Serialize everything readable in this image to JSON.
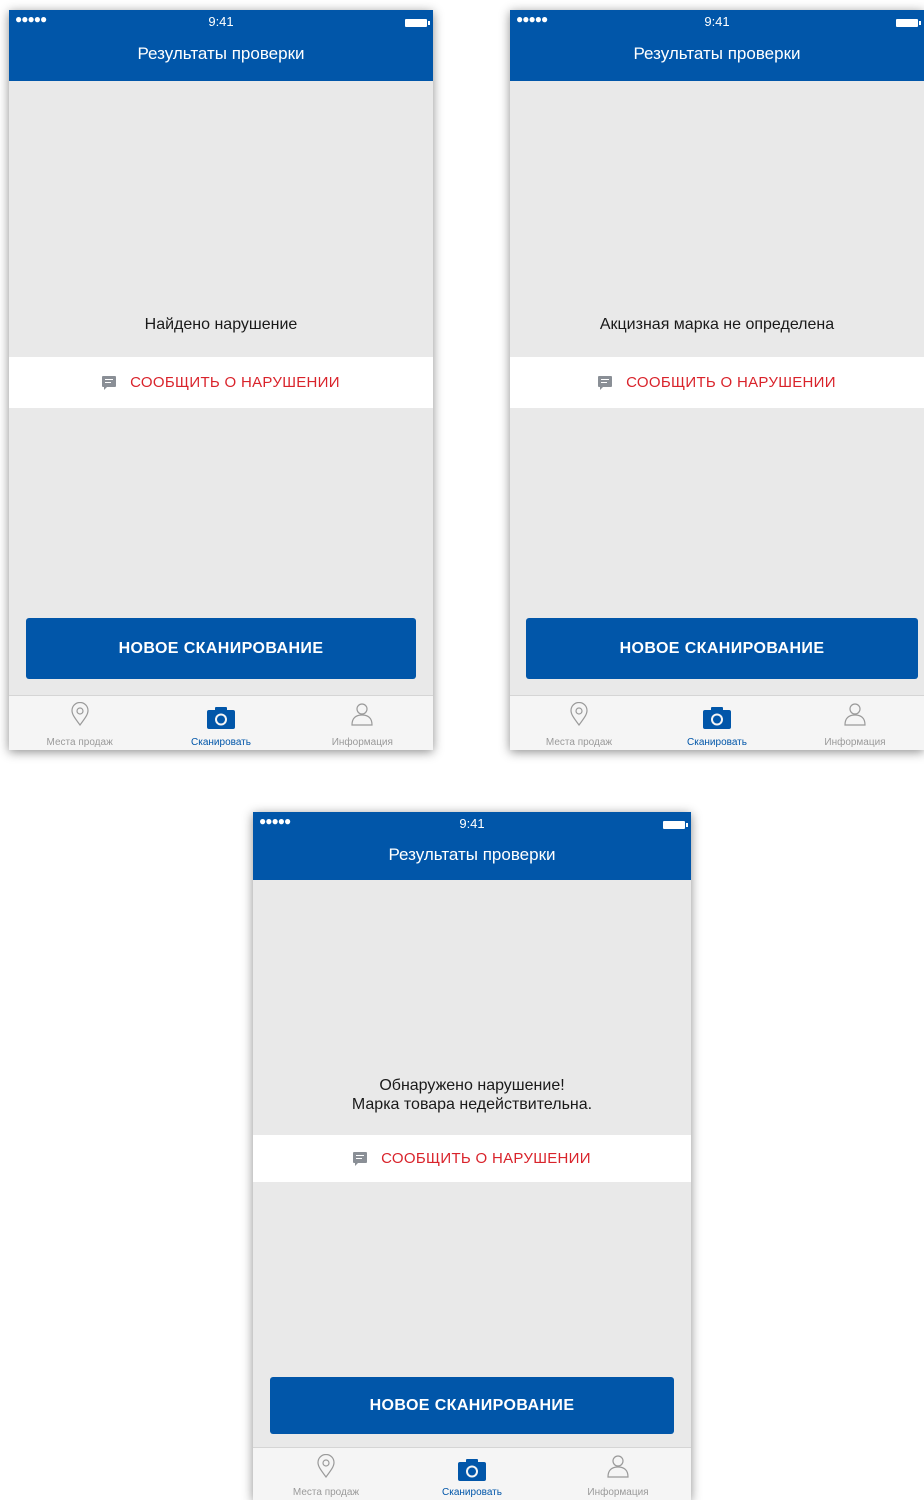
{
  "colors": {
    "header": "#0156a9",
    "background": "#e9e9e9",
    "report_text": "#d9232b",
    "primary_button": "#0156a9",
    "tab_active": "#0156a9",
    "tab_inactive": "#9a9a9a"
  },
  "screens": [
    {
      "status_bar": {
        "signal": "●●●●●",
        "time": "9:41"
      },
      "title": "Результаты проверки",
      "message": "Найдено нарушение",
      "report_label": "СООБЩИТЬ О НАРУШЕНИИ",
      "button_label": "НОВОЕ СКАНИРОВАНИЕ",
      "tabs": [
        {
          "label": "Места продаж",
          "icon": "map-pin-icon",
          "active": false
        },
        {
          "label": "Сканировать",
          "icon": "camera-icon",
          "active": true
        },
        {
          "label": "Информация",
          "icon": "person-icon",
          "active": false
        }
      ]
    },
    {
      "status_bar": {
        "signal": "●●●●●",
        "time": "9:41"
      },
      "title": "Результаты проверки",
      "message": "Акцизная марка не определена",
      "report_label": "СООБЩИТЬ О НАРУШЕНИИ",
      "button_label": "НОВОЕ СКАНИРОВАНИЕ",
      "tabs": [
        {
          "label": "Места продаж",
          "icon": "map-pin-icon",
          "active": false
        },
        {
          "label": "Сканировать",
          "icon": "camera-icon",
          "active": true
        },
        {
          "label": "Информация",
          "icon": "person-icon",
          "active": false
        }
      ]
    },
    {
      "status_bar": {
        "signal": "●●●●●",
        "time": "9:41"
      },
      "title": "Результаты проверки",
      "message_lines": [
        "Обнаружено нарушение!",
        "Марка товара недействительна."
      ],
      "report_label": "СООБЩИТЬ О НАРУШЕНИИ",
      "button_label": "НОВОЕ СКАНИРОВАНИЕ",
      "tabs": [
        {
          "label": "Места продаж",
          "icon": "map-pin-icon",
          "active": false
        },
        {
          "label": "Сканировать",
          "icon": "camera-icon",
          "active": true
        },
        {
          "label": "Информация",
          "icon": "person-icon",
          "active": false
        }
      ]
    }
  ]
}
